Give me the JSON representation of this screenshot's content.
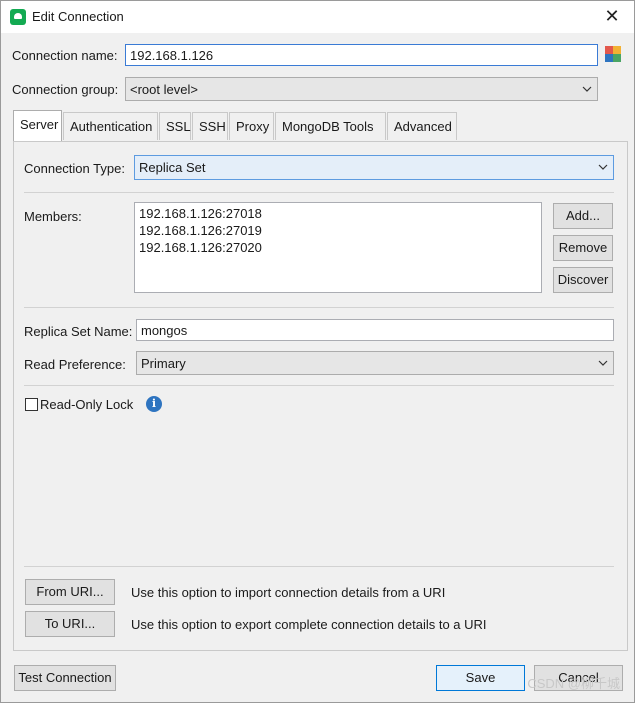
{
  "window": {
    "title": "Edit Connection",
    "close_glyph": "✕"
  },
  "connection_name": {
    "label": "Connection name:",
    "value": "192.168.1.126"
  },
  "connection_group": {
    "label": "Connection group:",
    "value": "<root level>"
  },
  "tabs": [
    {
      "label": "Server",
      "active": true
    },
    {
      "label": "Authentication"
    },
    {
      "label": "SSL"
    },
    {
      "label": "SSH"
    },
    {
      "label": "Proxy"
    },
    {
      "label": "MongoDB Tools"
    },
    {
      "label": "Advanced"
    }
  ],
  "server": {
    "connection_type": {
      "label": "Connection Type:",
      "value": "Replica Set"
    },
    "members": {
      "label": "Members:",
      "items": [
        "192.168.1.126:27018",
        "192.168.1.126:27019",
        "192.168.1.126:27020"
      ],
      "add_label": "Add...",
      "remove_label": "Remove",
      "discover_label": "Discover"
    },
    "replica_set_name": {
      "label": "Replica Set Name:",
      "value": "mongos"
    },
    "read_preference": {
      "label": "Read Preference:",
      "value": "Primary"
    },
    "read_only_lock": {
      "label": "Read-Only Lock",
      "checked": false,
      "info_glyph": "i"
    }
  },
  "uri": {
    "from_label": "From URI...",
    "from_desc": "Use this option to import connection details from a URI",
    "to_label": "To URI...",
    "to_desc": "Use this option to export complete connection details to a URI"
  },
  "footer": {
    "test_label": "Test Connection",
    "save_label": "Save",
    "cancel_label": "Cancel"
  },
  "watermark": "CSDN @柳千城",
  "colors": {
    "accent": "#0078d7",
    "app_icon": "#13aa52",
    "info": "#2e74c0"
  },
  "icons": [
    "app-icon",
    "close-icon",
    "color-picker-icon",
    "chevron-down-icon",
    "info-icon"
  ]
}
